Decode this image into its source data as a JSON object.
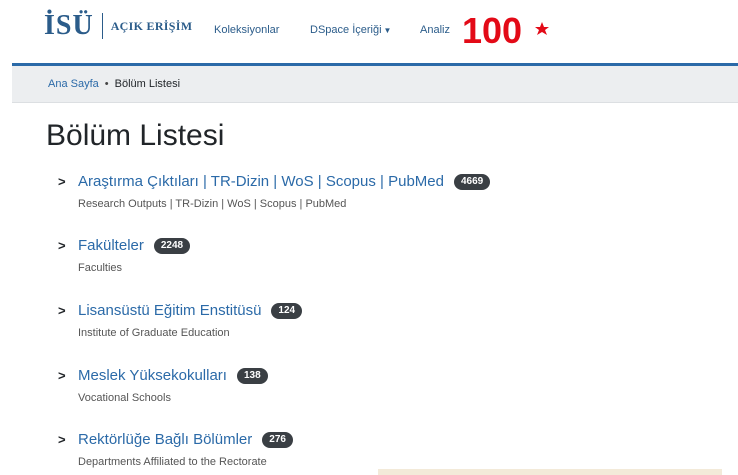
{
  "header": {
    "logo_text": "İSÜ",
    "logo_subtitle": "AÇIK ERİŞİM",
    "nav": {
      "koleksiyonlar": "Koleksiyonlar",
      "dspace": "DSpace İçeriği",
      "analiz": "Analiz"
    },
    "anniversary_logo": "100"
  },
  "breadcrumb": {
    "home": "Ana Sayfa",
    "separator": "•",
    "current": "Bölüm Listesi"
  },
  "page_title": "Bölüm Listesi",
  "items": [
    {
      "title": "Araştırma Çıktıları | TR-Dizin | WoS | Scopus | PubMed",
      "count": "4669",
      "description": "Research Outputs | TR-Dizin | WoS | Scopus | PubMed"
    },
    {
      "title": "Fakülteler",
      "count": "2248",
      "description": "Faculties"
    },
    {
      "title": "Lisansüstü Eğitim Enstitüsü",
      "count": "124",
      "description": "Institute of Graduate Education"
    },
    {
      "title": "Meslek Yüksekokulları",
      "count": "138",
      "description": "Vocational Schools"
    },
    {
      "title": "Rektörlüğe Bağlı Bölümler",
      "count": "276",
      "description": "Departments Affiliated to the Rectorate"
    }
  ],
  "colors": {
    "brand_blue": "#2b5c8a",
    "link_blue": "#2b6aa8",
    "badge_dark": "#3a3f44",
    "logo_red": "#e30a17"
  }
}
